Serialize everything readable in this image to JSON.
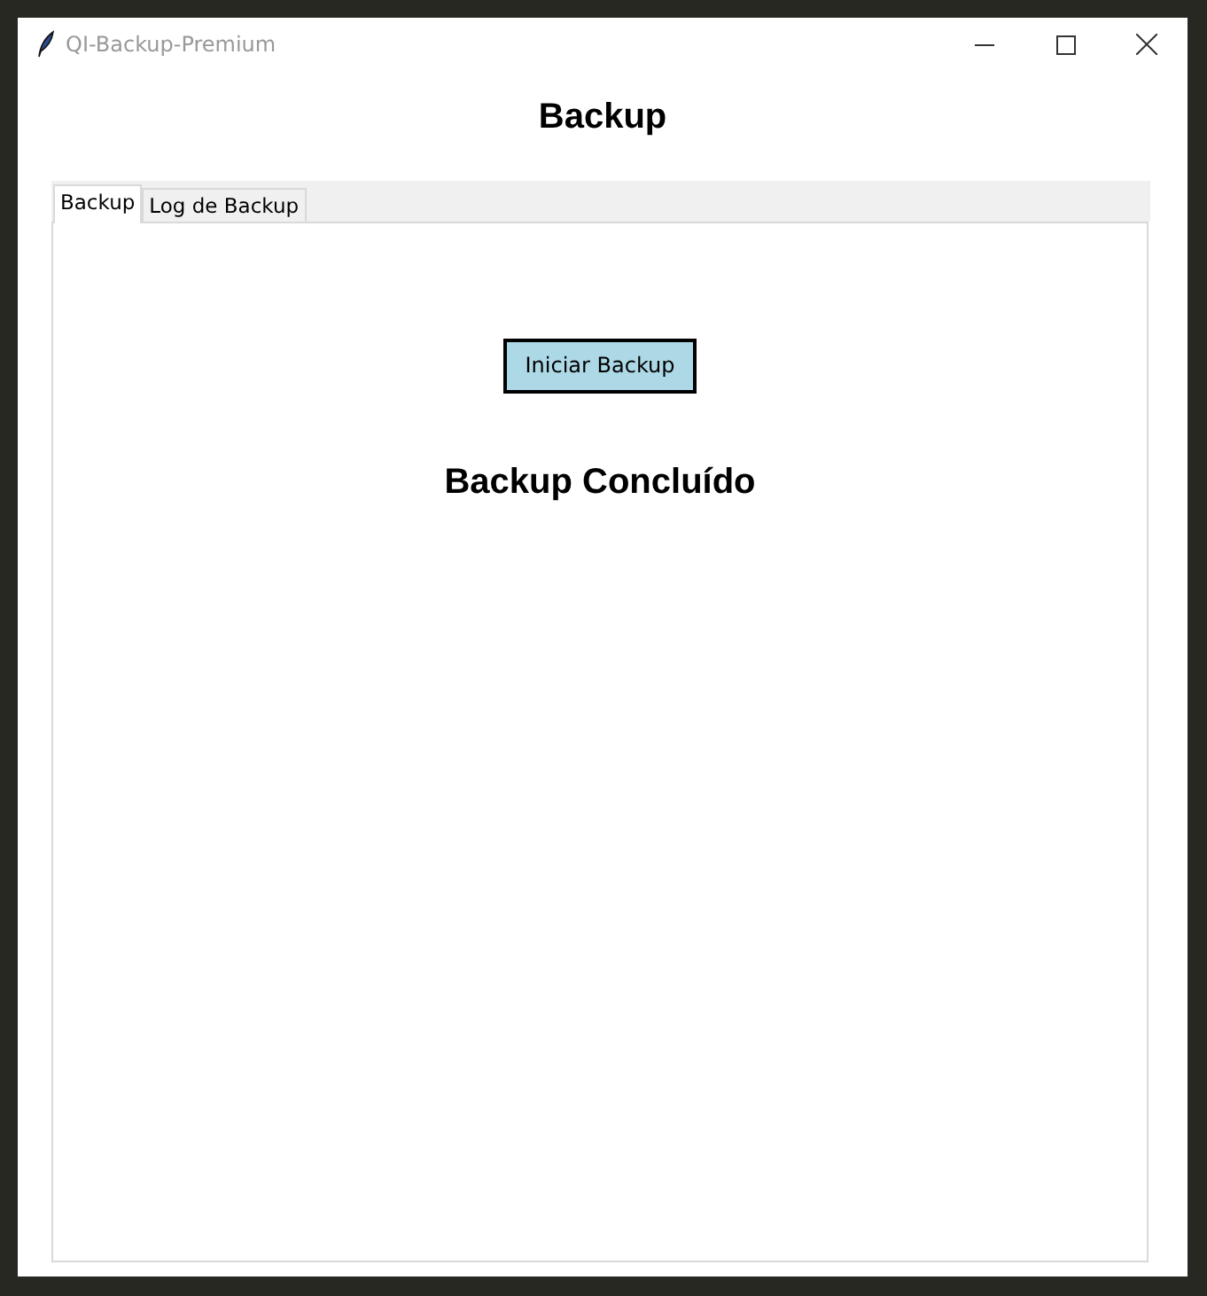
{
  "window": {
    "title": "QI-Backup-Premium"
  },
  "heading": "Backup",
  "tabs": [
    {
      "label": "Backup",
      "selected": true
    },
    {
      "label": "Log de Backup",
      "selected": false
    }
  ],
  "button": "Iniciar Backup",
  "status": "Backup Concluído"
}
